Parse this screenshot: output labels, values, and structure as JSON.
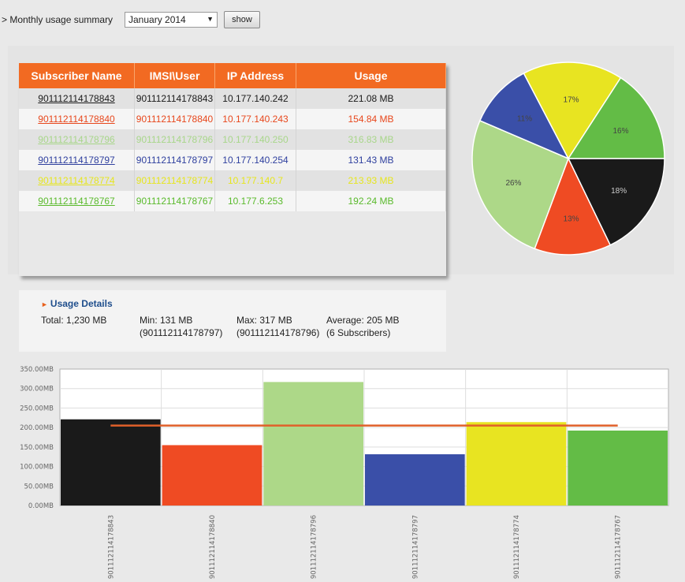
{
  "header": {
    "label": "> Monthly usage summary",
    "month_value": "January 2014",
    "dropdown_icon": "caret-down-icon",
    "show_label": "show"
  },
  "table": {
    "columns": [
      "Subscriber Name",
      "IMSI\\User",
      "IP Address",
      "Usage"
    ],
    "rows": [
      {
        "name": "901112114178843",
        "imsi": "901112114178843",
        "ip": "10.177.140.242",
        "usage": "221.08 MB",
        "color": "#1a1a1a"
      },
      {
        "name": "901112114178840",
        "imsi": "901112114178840",
        "ip": "10.177.140.243",
        "usage": "154.84 MB",
        "color": "#e8471c"
      },
      {
        "name": "901112114178796",
        "imsi": "901112114178796",
        "ip": "10.177.140.250",
        "usage": "316.83 MB",
        "color": "#a8d68a"
      },
      {
        "name": "901112114178797",
        "imsi": "901112114178797",
        "ip": "10.177.140.254",
        "usage": "131.43 MB",
        "color": "#2e3f9e"
      },
      {
        "name": "901112114178774",
        "imsi": "901112114178774",
        "ip": "10.177.140.7",
        "usage": "213.93 MB",
        "color": "#e6e61e"
      },
      {
        "name": "901112114178767",
        "imsi": "901112114178767",
        "ip": "10.177.6.253",
        "usage": "192.24 MB",
        "color": "#5aba2c"
      }
    ]
  },
  "usage_details": {
    "title": "Usage Details",
    "total": "Total: 1,230 MB",
    "min": "Min: 131 MB",
    "min_sub": "(901112114178797)",
    "max": "Max: 317 MB",
    "max_sub": "(901112114178796)",
    "avg": "Average: 205 MB",
    "avg_sub": "(6 Subscribers)"
  },
  "pie_data": {
    "type": "pie",
    "slices": [
      {
        "label": "18%",
        "value": 18,
        "color": "#1a1a1a"
      },
      {
        "label": "13%",
        "value": 13,
        "color": "#ef4b23"
      },
      {
        "label": "26%",
        "value": 26,
        "color": "#add888"
      },
      {
        "label": "11%",
        "value": 11,
        "color": "#3a4fa8"
      },
      {
        "label": "17%",
        "value": 17,
        "color": "#e8e421"
      },
      {
        "label": "16%",
        "value": 16,
        "color": "#63bc46"
      }
    ]
  },
  "chart_data": {
    "type": "bar",
    "categories": [
      "901112114178843",
      "901112114178840",
      "901112114178796",
      "901112114178797",
      "901112114178774",
      "901112114178767"
    ],
    "values": [
      221.08,
      154.84,
      316.83,
      131.43,
      213.93,
      192.24
    ],
    "colors": [
      "#1a1a1a",
      "#ef4b23",
      "#add888",
      "#3a4fa8",
      "#e8e421",
      "#63bc46"
    ],
    "average": 205,
    "average_color": "#e0602a",
    "ylim": [
      0,
      350
    ],
    "yticks": [
      "0.00MB",
      "50.00MB",
      "100.00MB",
      "150.00MB",
      "200.00MB",
      "250.00MB",
      "300.00MB",
      "350.00MB"
    ],
    "grid": true
  }
}
